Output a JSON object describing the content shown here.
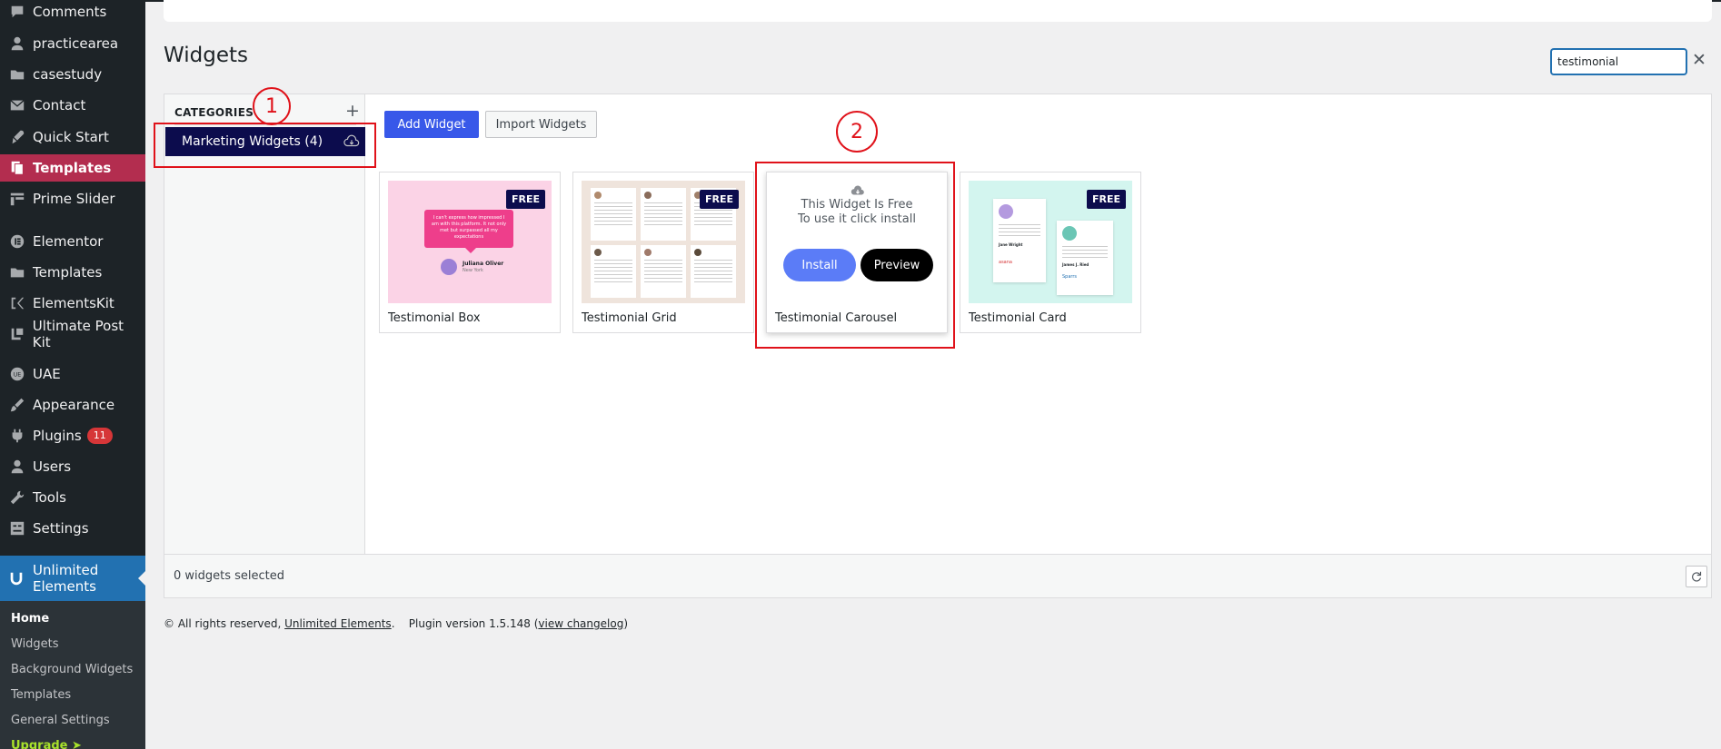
{
  "sidebar": {
    "items": [
      {
        "label": "Comments",
        "icon": "comments-icon"
      },
      {
        "label": "practicearea",
        "icon": "user-icon"
      },
      {
        "label": "casestudy",
        "icon": "folder-icon"
      },
      {
        "label": "Contact",
        "icon": "mail-icon"
      },
      {
        "label": "Quick Start",
        "icon": "rocket-icon"
      },
      {
        "label": "Templates",
        "icon": "templates-icon"
      },
      {
        "label": "Prime Slider",
        "icon": "slider-icon"
      },
      {
        "label": "Elementor",
        "icon": "elementor-icon"
      },
      {
        "label": "Templates",
        "icon": "folder-icon"
      },
      {
        "label": "ElementsKit",
        "icon": "elementskit-icon"
      },
      {
        "label": "Ultimate Post Kit",
        "icon": "upk-icon"
      },
      {
        "label": "UAE",
        "icon": "uae-icon"
      },
      {
        "label": "Appearance",
        "icon": "brush-icon"
      },
      {
        "label": "Plugins",
        "icon": "plugin-icon",
        "badge": "11"
      },
      {
        "label": "Users",
        "icon": "user-icon"
      },
      {
        "label": "Tools",
        "icon": "wrench-icon"
      },
      {
        "label": "Settings",
        "icon": "settings-icon"
      }
    ],
    "current": "Unlimited Elements",
    "submenu": [
      "Home",
      "Widgets",
      "Background Widgets",
      "Templates",
      "General Settings",
      "Upgrade ➤"
    ]
  },
  "page": {
    "title": "Widgets"
  },
  "search": {
    "value": "testimonial"
  },
  "categories": {
    "title": "CATEGORIES",
    "add": "+",
    "item": "Marketing Widgets (4)"
  },
  "toolbar": {
    "add_label": "Add Widget",
    "import_label": "Import Widgets"
  },
  "widgets": [
    {
      "name": "Testimonial Box",
      "badge": "FREE",
      "quote": "I can't express how impressed I am with this platform. It not only met but surpassed all my expectations",
      "person": "Juliana Oliver",
      "location": "New York"
    },
    {
      "name": "Testimonial Grid",
      "badge": "FREE"
    },
    {
      "name": "Testimonial Carousel",
      "free_line1": "This Widget Is Free",
      "free_line2": "To use it click install",
      "install": "Install",
      "preview": "Preview"
    },
    {
      "name": "Testimonial Card",
      "badge": "FREE",
      "person1": "Jane Wright",
      "person2": "James J. Ried",
      "brand": "asana",
      "brand2": "Sparrs"
    }
  ],
  "status": {
    "text": "0 widgets selected"
  },
  "footer": {
    "rights": "© All rights reserved,",
    "company": "Unlimited Elements",
    "version": "Plugin version 1.5.148 (",
    "changelog": "view changelog",
    "close": ")"
  },
  "annotations": [
    "1",
    "2"
  ],
  "colors": {
    "sidebar": "#1d2327",
    "active": "#b32d4f",
    "accent": "#2271b1",
    "category": "#0c0c4d",
    "button": "#3858e9",
    "annotation": "#e0121a"
  }
}
